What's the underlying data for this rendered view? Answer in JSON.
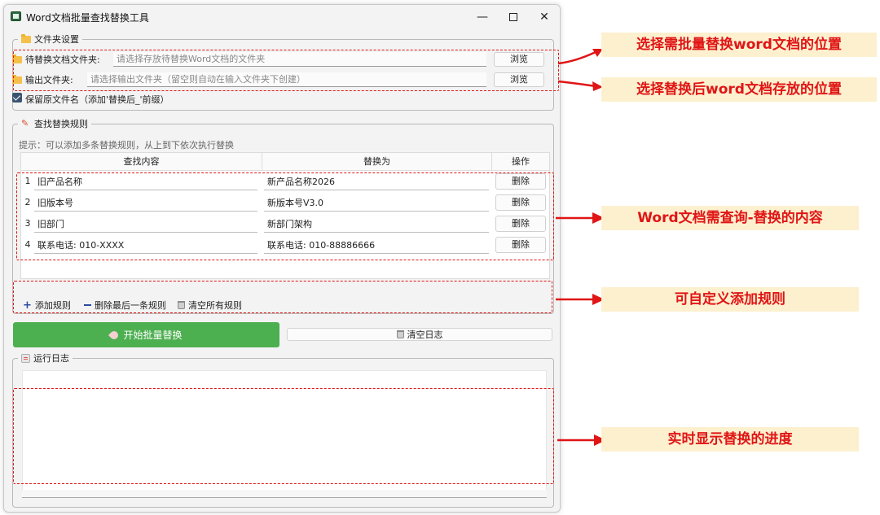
{
  "window": {
    "title": "Word文档批量查找替换工具",
    "minimize": "—",
    "close": "✕"
  },
  "folder_group": {
    "title": "文件夹设置",
    "source_label": "待替换文档文件夹:",
    "source_placeholder": "请选择存放待替换Word文档的文件夹",
    "source_browse": "浏览",
    "output_label": "输出文件夹:",
    "output_placeholder": "请选择输出文件夹（留空则自动在输入文件夹下创建）",
    "output_browse": "浏览",
    "keep_name_label": "保留原文件名（添加'替换后_'前缀）",
    "keep_name_checked": true
  },
  "rules_group": {
    "title": "查找替换规则",
    "hint": "提示：可以添加多条替换规则，从上到下依次执行替换",
    "headers": [
      "查找内容",
      "替换为",
      "操作"
    ],
    "rows": [
      {
        "num": "1",
        "find": "旧产品名称",
        "replace": "新产品名称2026",
        "action": "删除"
      },
      {
        "num": "2",
        "find": "旧版本号",
        "replace": "新版本号V3.0",
        "action": "删除"
      },
      {
        "num": "3",
        "find": "旧部门",
        "replace": "新部门架构",
        "action": "删除"
      },
      {
        "num": "4",
        "find": "联系电话: 010-XXXX",
        "replace": "联系电话: 010-88886666",
        "action": "删除"
      }
    ],
    "add_rule": "添加规则",
    "delete_last": "删除最后一条规则",
    "clear_all": "清空所有规则"
  },
  "actions": {
    "start": "开始批量替换",
    "clear_log": "清空日志"
  },
  "log_group": {
    "title": "运行日志"
  },
  "callouts": [
    "选择需批量替换word文档的位置",
    "选择替换后word文档存放的位置",
    "Word文档需查询-替换的内容",
    "可自定义添加规则",
    "实时显示替换的进度"
  ],
  "colors": {
    "accent_green": "#4caf50",
    "annotation_red": "#e01515",
    "callout_bg": "#fdf0cf"
  }
}
